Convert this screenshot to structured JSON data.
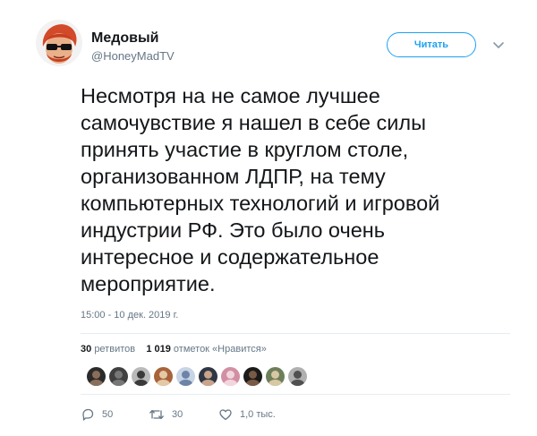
{
  "author": {
    "name": "Медовый",
    "handle": "@HoneyMadTV",
    "avatar_icon": "avatar-redhead-sunglasses"
  },
  "follow_button_label": "Читать",
  "menu_icon": "chevron-down-icon",
  "tweet": {
    "lines": [
      "Несмотря на не самое лучшее",
      "самочувствие я нашел в себе силы",
      "принять участие в круглом столе,",
      "организованном ЛДПР, на тему",
      "компьютерных технологий и игровой",
      "индустрии РФ. Это было очень",
      "интересное и содержательное",
      "мероприятие."
    ],
    "timestamp": "15:00 - 10 дек. 2019 г."
  },
  "stats": {
    "retweets_count": "30",
    "retweets_label": "ретвитов",
    "likes_count": "1 019",
    "likes_label": "отметок «Нравится»"
  },
  "liker_avatars": [
    {
      "name": "liker-1",
      "bg": "#2b2b2b",
      "fg": "#8a6e5a"
    },
    {
      "name": "liker-2",
      "bg": "#404040",
      "fg": "#777777"
    },
    {
      "name": "liker-3",
      "bg": "#b9b9b9",
      "fg": "#3a3a3a"
    },
    {
      "name": "liker-4",
      "bg": "#a8633a",
      "fg": "#e4c9a6"
    },
    {
      "name": "liker-5",
      "bg": "#c8d4e4",
      "fg": "#6b84a8"
    },
    {
      "name": "liker-6",
      "bg": "#2f3645",
      "fg": "#c9a48a"
    },
    {
      "name": "liker-7",
      "bg": "#d28fa3",
      "fg": "#f2d6de"
    },
    {
      "name": "liker-8",
      "bg": "#1a1a1a",
      "fg": "#7a5a45"
    },
    {
      "name": "liker-9",
      "bg": "#6d7f5a",
      "fg": "#d9c7a3"
    },
    {
      "name": "liker-10",
      "bg": "#b0b0b0",
      "fg": "#505050"
    }
  ],
  "actions": {
    "reply_count": "50",
    "retweet_count": "30",
    "like_count": "1,0 тыс."
  },
  "colors": {
    "accent": "#1da1f2",
    "secondary_text": "#657786",
    "primary_text": "#14171a",
    "divider": "#e6ecf0"
  }
}
